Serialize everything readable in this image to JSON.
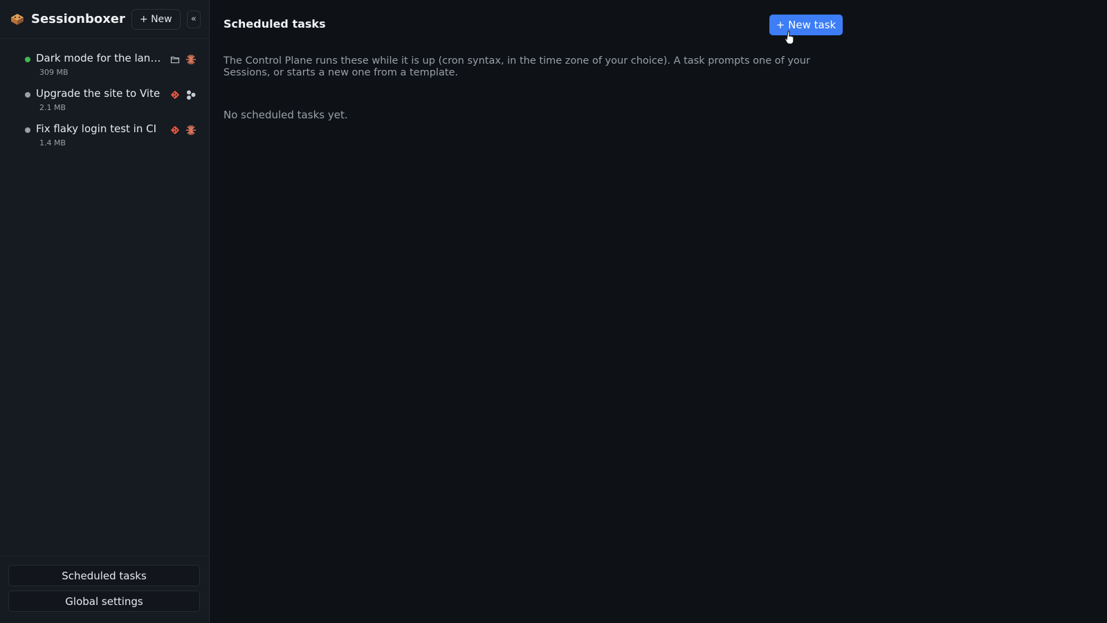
{
  "sidebar": {
    "app_name": "Sessionboxer",
    "new_label": "+ New",
    "collapse_label": "«",
    "sessions": [
      {
        "title": "Dark mode for the landing page",
        "size": "309 MB",
        "status": "active",
        "status_color": "#3fb950",
        "icons": [
          "folder-icon",
          "claude-burst-icon"
        ]
      },
      {
        "title": "Upgrade the site to Vite",
        "size": "2.1 MB",
        "status": "idle",
        "status_color": "#9aa0a8",
        "icons": [
          "git-icon",
          "nodes-icon"
        ]
      },
      {
        "title": "Fix flaky login test in CI",
        "size": "1.4 MB",
        "status": "idle",
        "status_color": "#9aa0a8",
        "icons": [
          "git-icon",
          "claude-burst-icon"
        ]
      }
    ],
    "footer": {
      "scheduled_tasks_label": "Scheduled tasks",
      "global_settings_label": "Global settings"
    }
  },
  "main": {
    "title": "Scheduled tasks",
    "new_task_label": "+ New task",
    "description": "The Control Plane runs these while it is up (cron syntax, in the time zone of your choice). A task prompts one of your Sessions, or starts a new one from a template.",
    "empty_state": "No scheduled tasks yet."
  },
  "colors": {
    "accent": "#3d7df5",
    "background": "#0e1116",
    "sidebar_bg": "#161a21",
    "git_icon": "#e5533d",
    "claude_icon": "#d9775a"
  }
}
